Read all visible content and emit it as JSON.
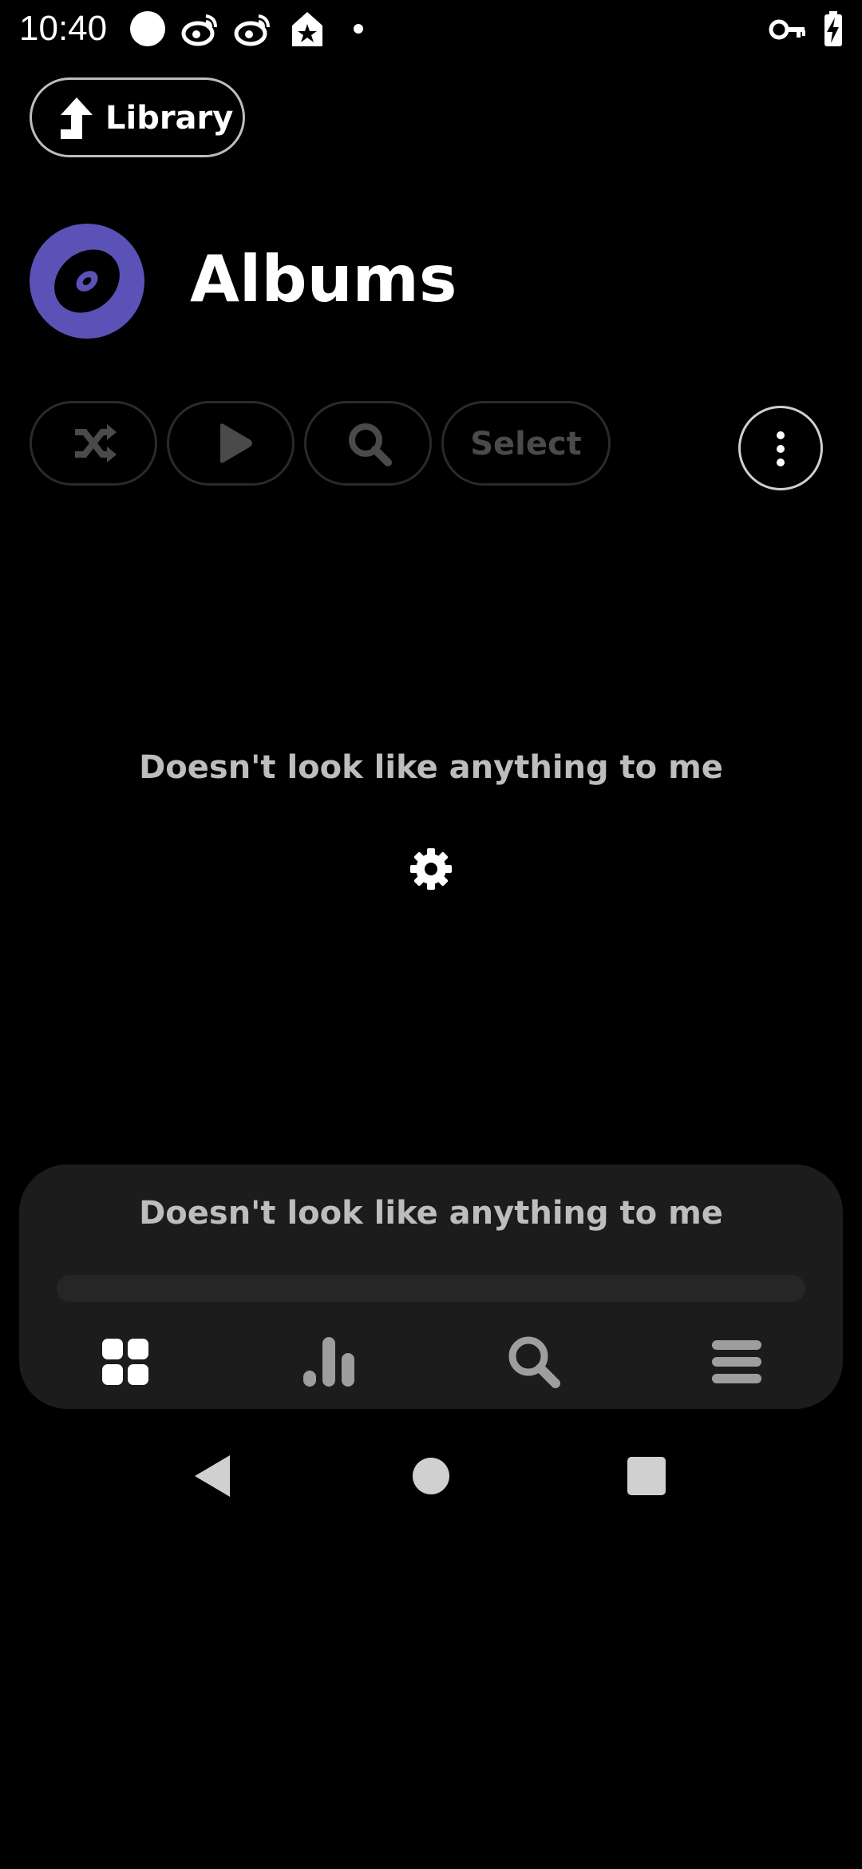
{
  "status_bar": {
    "time": "10:40",
    "icons": [
      "circle-icon",
      "weibo-icon",
      "weibo-icon",
      "tag-star-icon",
      "dot-icon",
      "vpn-key-icon",
      "battery-charging-icon"
    ]
  },
  "header": {
    "back_label": "Library",
    "title": "Albums",
    "title_icon": "album-disc-icon"
  },
  "actions": {
    "buttons": [
      "shuffle-icon",
      "play-icon",
      "search-icon"
    ],
    "select_label": "Select",
    "more_icon": "more-vert-icon"
  },
  "empty_state": {
    "message": "Doesn't look like anything to me",
    "icon": "gear-icon"
  },
  "player": {
    "now_playing": "Doesn't look like anything to me",
    "progress": 0
  },
  "bottom_nav": {
    "items": [
      "grid-icon",
      "bar-chart-icon",
      "search-icon",
      "menu-icon"
    ]
  },
  "system_nav": [
    "back-icon",
    "home-icon",
    "recents-icon"
  ],
  "colors": {
    "accent": "#5b52b8",
    "background": "#000000",
    "panel": "#1c1c1c",
    "muted_text": "#bdbdbd"
  }
}
